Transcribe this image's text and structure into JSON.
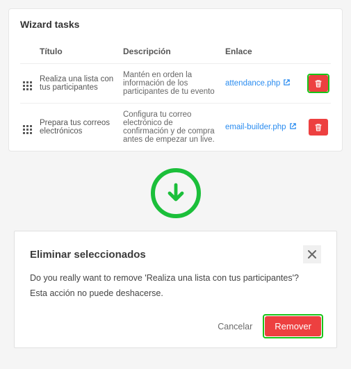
{
  "card": {
    "title": "Wizard tasks",
    "headers": {
      "titulo": "Título",
      "desc": "Descripción",
      "enlace": "Enlace"
    },
    "rows": [
      {
        "title": "Realiza una lista con tus participantes",
        "desc": "Mantén en orden la información de los participantes de tu evento",
        "link": "attendance.php",
        "highlight": true
      },
      {
        "title": "Prepara tus correos electrónicos",
        "desc": "Configura tu correo electrónico de confirmación y de compra antes de empezar un live.",
        "link": "email-builder.php",
        "highlight": false
      }
    ]
  },
  "modal": {
    "title": "Eliminar seleccionados",
    "line1": "Do you really want to remove 'Realiza una lista con tus participantes'?",
    "line2": "Esta acción no puede deshacerse.",
    "cancel": "Cancelar",
    "remove": "Remover"
  }
}
